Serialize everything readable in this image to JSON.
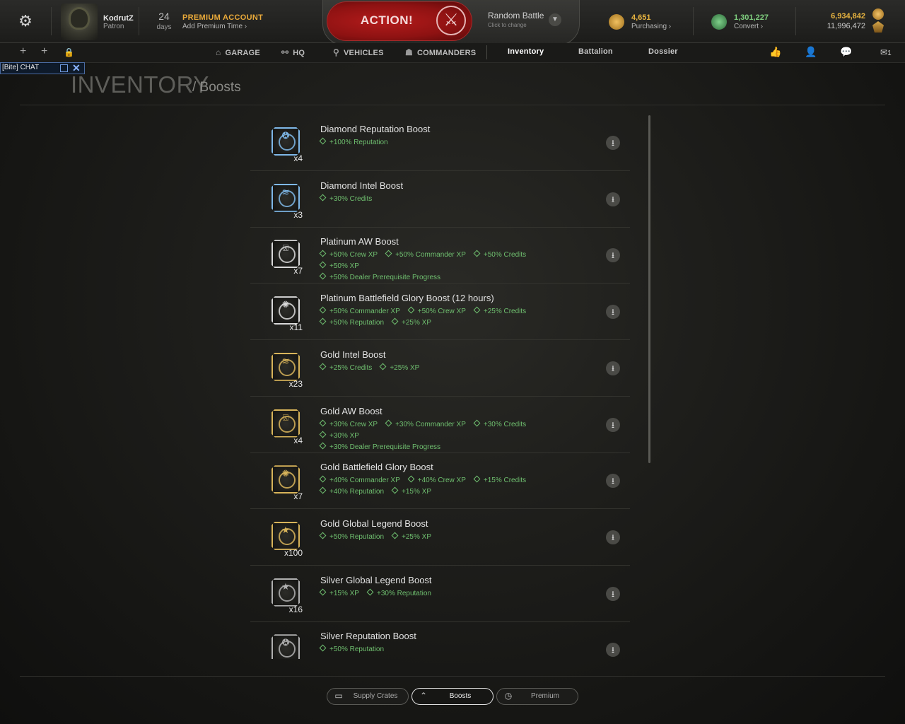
{
  "header": {
    "username": "KodrutZ",
    "rank": "Patron",
    "premium_days": "24",
    "premium_days_label": "days",
    "premium_title": "PREMIUM ACCOUNT",
    "premium_link": "Add Premium Time",
    "action_label": "ACTION!",
    "battle_mode": "Random Battle",
    "battle_mode_hint": "Click to change",
    "gold_value": "4,651",
    "gold_link": "Purchasing",
    "credits_value": "1,301,227",
    "credits_link": "Convert",
    "xp_value_1": "6,934,842",
    "xp_value_2": "11,996,472"
  },
  "nav": {
    "garage": "GARAGE",
    "hq": "HQ",
    "vehicles": "VEHICLES",
    "commanders": "COMMANDERS",
    "inventory": "Inventory",
    "battalion": "Battalion",
    "dossier": "Dossier",
    "invites_count": "1"
  },
  "chat": {
    "label": "[Bite] CHAT"
  },
  "page": {
    "title": "INVENTORY",
    "subtitle": "/ Boosts"
  },
  "items": [
    {
      "name": "Diamond Reputation Boost",
      "qty": "x4",
      "tier": "diamond",
      "icon": "reputation-icon",
      "bonuses": [
        "+100% Reputation"
      ]
    },
    {
      "name": "Diamond Intel Boost",
      "qty": "x3",
      "tier": "diamond",
      "icon": "intel-icon",
      "bonuses": [
        "+30% Credits"
      ]
    },
    {
      "name": "Platinum AW Boost",
      "qty": "x7",
      "tier": "platinum",
      "icon": "aw-icon",
      "bonuses": [
        "+50% Crew XP",
        "+50% Commander XP",
        "+50% Credits",
        "+50% XP",
        "+50% Dealer Prerequisite Progress"
      ]
    },
    {
      "name": "Platinum Battlefield Glory Boost (12 hours)",
      "qty": "x11",
      "tier": "platinum",
      "icon": "glory-icon",
      "bonuses": [
        "+50% Commander XP",
        "+50% Crew XP",
        "+25% Credits",
        "+50% Reputation",
        "+25% XP"
      ]
    },
    {
      "name": "Gold Intel Boost",
      "qty": "x23",
      "tier": "gold",
      "icon": "intel-icon",
      "bonuses": [
        "+25% Credits",
        "+25% XP"
      ]
    },
    {
      "name": "Gold AW Boost",
      "qty": "x4",
      "tier": "gold",
      "icon": "aw-icon",
      "bonuses": [
        "+30% Crew XP",
        "+30% Commander XP",
        "+30% Credits",
        "+30% XP",
        "+30% Dealer Prerequisite Progress"
      ]
    },
    {
      "name": "Gold Battlefield Glory Boost",
      "qty": "x7",
      "tier": "gold",
      "icon": "glory-icon",
      "bonuses": [
        "+40% Commander XP",
        "+40% Crew XP",
        "+15% Credits",
        "+40% Reputation",
        "+15% XP"
      ]
    },
    {
      "name": "Gold Global Legend Boost",
      "qty": "x100",
      "tier": "gold",
      "icon": "legend-icon",
      "bonuses": [
        "+50% Reputation",
        "+25% XP"
      ]
    },
    {
      "name": "Silver Global Legend Boost",
      "qty": "x16",
      "tier": "silver",
      "icon": "legend-icon",
      "bonuses": [
        "+15% XP",
        "+30% Reputation"
      ]
    },
    {
      "name": "Silver Reputation Boost",
      "qty": "",
      "tier": "silver",
      "icon": "reputation-icon",
      "bonuses": [
        "+50% Reputation"
      ]
    }
  ],
  "tier_colors": {
    "diamond": "#7fb8e8",
    "platinum": "#d9d9d9",
    "gold": "#d8b45a",
    "silver": "#b0b0b0"
  },
  "tabs": {
    "supply": "Supply Crates",
    "boosts": "Boosts",
    "premium": "Premium"
  }
}
